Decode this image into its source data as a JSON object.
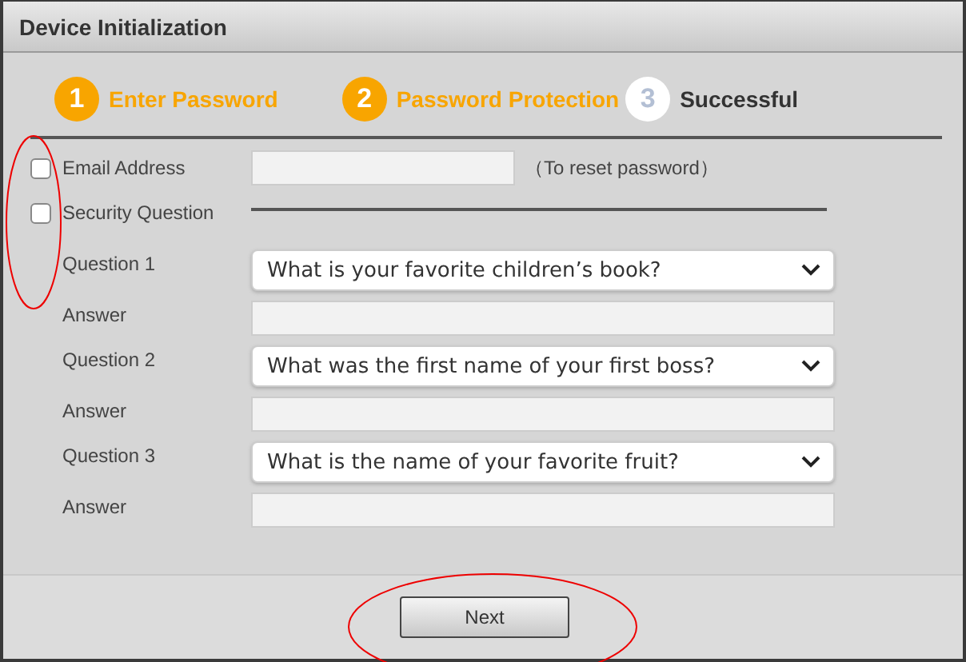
{
  "window": {
    "title": "Device Initialization"
  },
  "steps": [
    {
      "number": "1",
      "label": "Enter Password",
      "reached": true
    },
    {
      "number": "2",
      "label": "Password Protection",
      "reached": true
    },
    {
      "number": "3",
      "label": "Successful",
      "reached": false
    }
  ],
  "options_circled": true,
  "email": {
    "label": "Email Address",
    "checked": false,
    "hint": "（To reset password）"
  },
  "security": {
    "label": "Security Question",
    "checked": false
  },
  "questions": [
    {
      "label": "Question 1",
      "value": "What is your favorite children’s book?",
      "answer_label": "Answer"
    },
    {
      "label": "Question 2",
      "value": "What was the first name of your first boss?",
      "answer_label": "Answer"
    },
    {
      "label": "Question 3",
      "value": "What is the name of your favorite fruit?",
      "answer_label": "Answer"
    }
  ],
  "next_button": {
    "label": "Next",
    "circled": true
  }
}
